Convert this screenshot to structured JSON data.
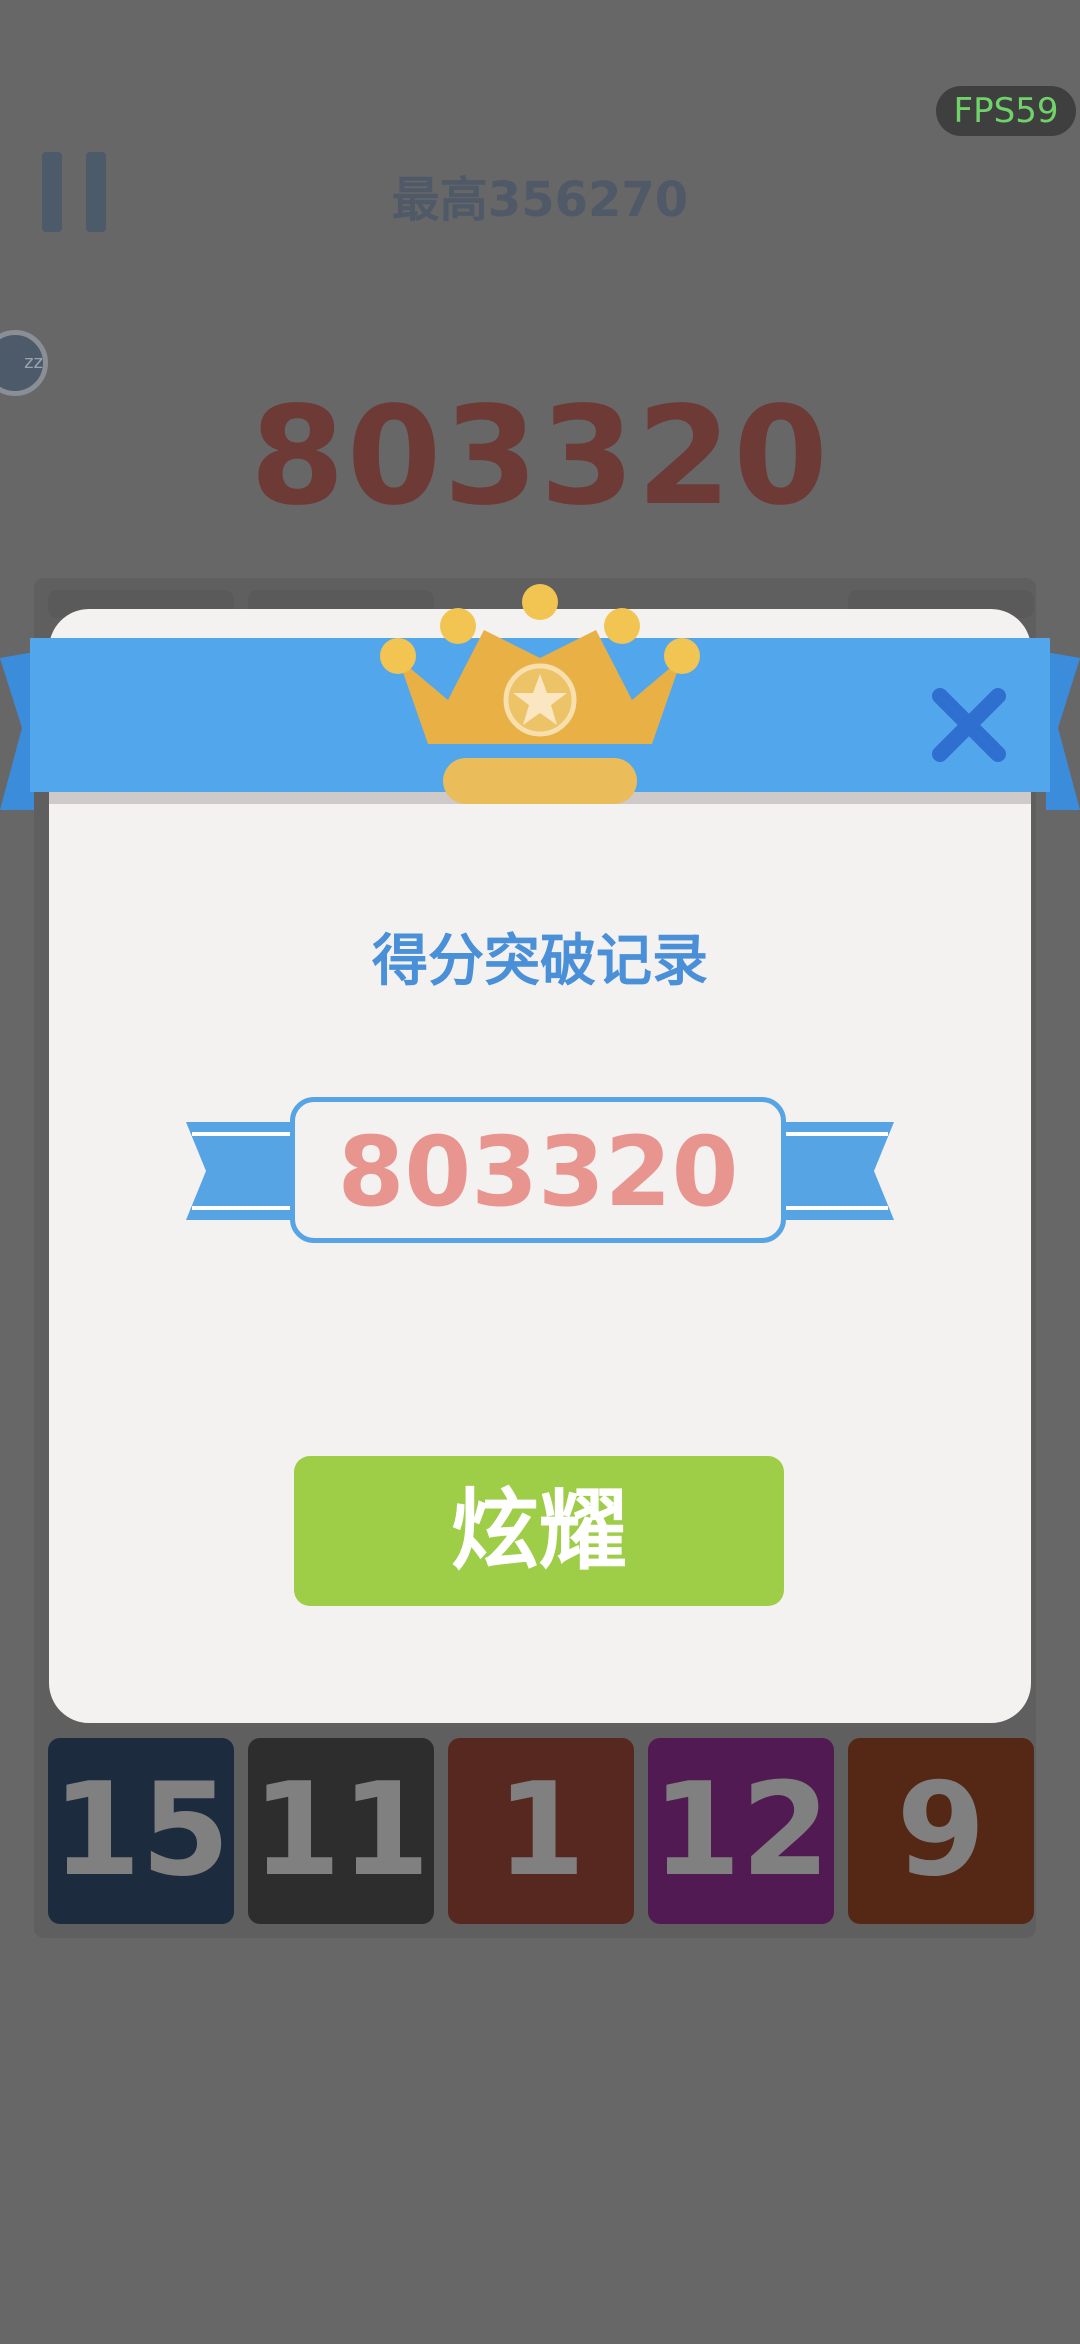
{
  "status": {
    "fps": "FPS59"
  },
  "header": {
    "best_label": "最高356270",
    "sleep_icon_text": "zz"
  },
  "game": {
    "current_score": "803320",
    "bottom_row": [
      {
        "value": "15",
        "color": "#1d2b3f"
      },
      {
        "value": "11",
        "color": "#2d2d2d"
      },
      {
        "value": "1",
        "color": "#57281f"
      },
      {
        "value": "12",
        "color": "#521a52"
      },
      {
        "value": "9",
        "color": "#542815"
      }
    ]
  },
  "modal": {
    "title": "得分突破记录",
    "record_score": "803320",
    "action_label": "炫耀",
    "colors": {
      "ribbon": "#52a6ec",
      "crown": "#e8b045",
      "button": "#9ecd48",
      "score": "#e8958f"
    }
  }
}
